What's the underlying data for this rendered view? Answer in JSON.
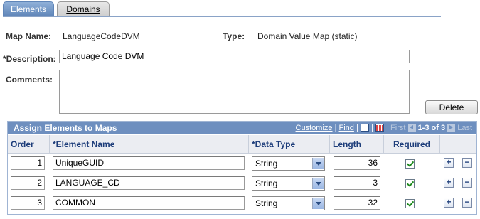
{
  "tabs": [
    {
      "label": "Elements",
      "active": true
    },
    {
      "label": "Domains",
      "active": false
    }
  ],
  "header": {
    "map_name_label": "Map Name:",
    "map_name_value": "LanguageCodeDVM",
    "type_label": "Type:",
    "type_value": "Domain Value Map (static)",
    "description_label": "*Description:",
    "description_value": "Language Code DVM",
    "comments_label": "Comments:",
    "comments_value": ""
  },
  "delete_label": "Delete",
  "grid": {
    "title": "Assign Elements to Maps",
    "customize": "Customize",
    "find": "Find",
    "first": "First",
    "range": "1-3 of 3",
    "last": "Last",
    "columns": {
      "order": "Order",
      "element_name": "*Element Name",
      "data_type": "*Data Type",
      "length": "Length",
      "required": "Required"
    },
    "rows": [
      {
        "order": "1",
        "element_name": "UniqueGUID",
        "data_type": "String",
        "length": "36",
        "required": true
      },
      {
        "order": "2",
        "element_name": "LANGUAGE_CD",
        "data_type": "String",
        "length": "3",
        "required": true
      },
      {
        "order": "3",
        "element_name": "COMMON",
        "data_type": "String",
        "length": "32",
        "required": true
      }
    ]
  },
  "colors": {
    "grid_header": "#6e8fbf",
    "tab_active": "#5f85b8",
    "checkmark": "#1f8a1f"
  }
}
